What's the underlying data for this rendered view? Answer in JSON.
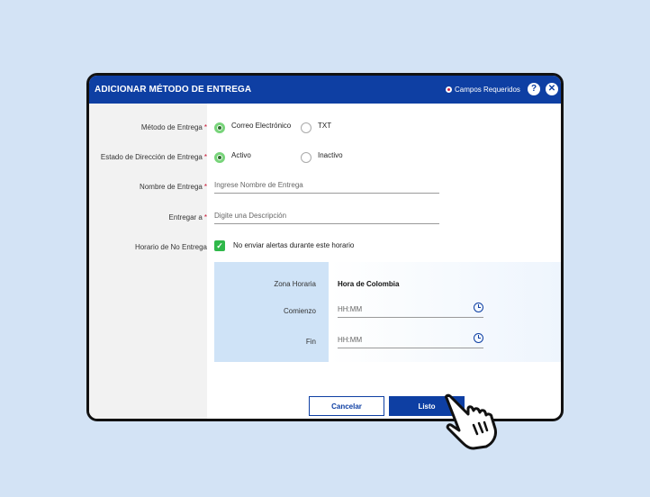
{
  "header": {
    "title": "ADICIONAR MÉTODO DE ENTREGA",
    "required_label": "Campos Requeridos",
    "help_symbol": "?",
    "close_symbol": "✕",
    "color": "#0e3fa3"
  },
  "form": {
    "delivery_method": {
      "label": "Método de Entrega",
      "options": [
        "Correo Electrónico",
        "TXT"
      ],
      "selected": "Correo Electrónico"
    },
    "address_status": {
      "label": "Estado de Dirección de Entrega",
      "options": [
        "Activo",
        "Inactivo"
      ],
      "selected": "Activo"
    },
    "delivery_name": {
      "label": "Nombre de Entrega",
      "placeholder": "Ingrese Nombre de Entrega"
    },
    "deliver_to": {
      "label": "Entregar a",
      "placeholder": "Digite una Descripción"
    },
    "no_delivery_schedule": {
      "label": "Horario de No Entrega",
      "checkbox_label": "No enviar alertas durante este horario",
      "checked": true
    },
    "schedule": {
      "timezone_label": "Zona Horaria",
      "timezone_value": "Hora de Colombia",
      "start_label": "Comienzo",
      "start_placeholder": "HH:MM",
      "end_label": "Fin",
      "end_placeholder": "HH:MM"
    }
  },
  "buttons": {
    "cancel": "Cancelar",
    "ok": "Listo"
  },
  "colors": {
    "primary": "#0e3fa3",
    "required": "#c8102e",
    "radio_selected": "#78d47a",
    "checkbox": "#2fb84a",
    "background": "#d3e3f5"
  },
  "icons": [
    "required-dot-icon",
    "help-icon",
    "close-icon",
    "check-icon",
    "clock-icon",
    "pointing-hand-icon"
  ]
}
